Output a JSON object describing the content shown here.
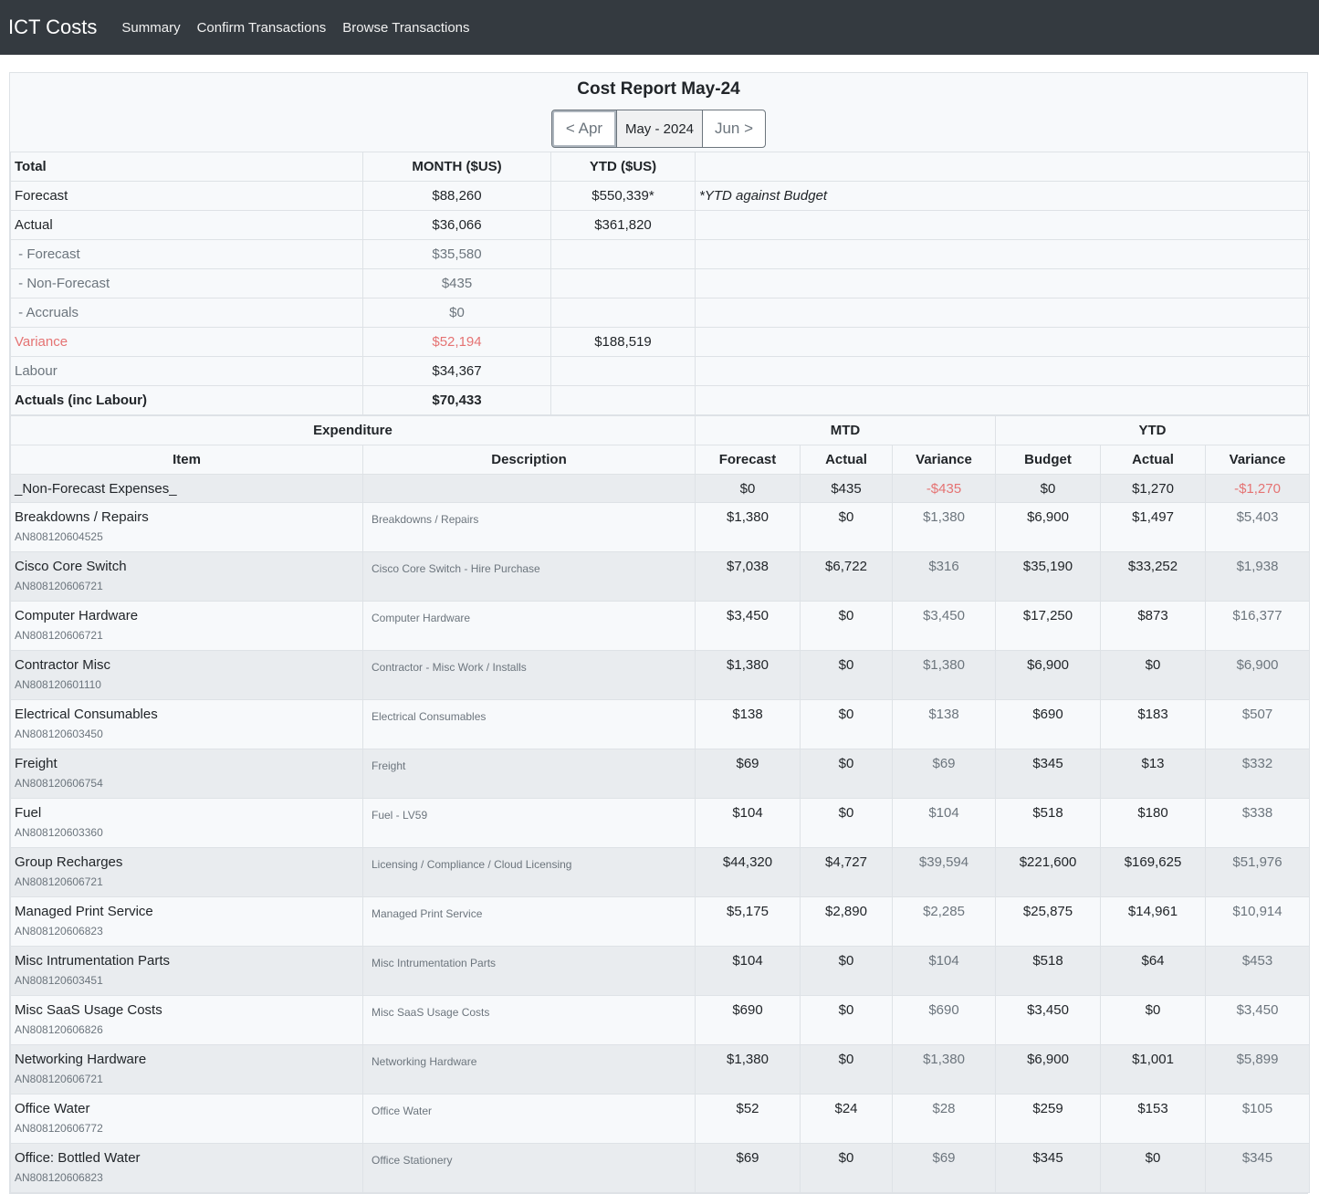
{
  "nav": {
    "brand": "ICT Costs",
    "links": [
      "Summary",
      "Confirm Transactions",
      "Browse Transactions"
    ]
  },
  "report": {
    "title": "Cost Report May-24",
    "prev": "< Apr",
    "current": "May - 2024",
    "next": "Jun >"
  },
  "summary": {
    "headers": [
      "Total",
      "MONTH ($US)",
      "YTD ($US)"
    ],
    "rows": [
      {
        "label": "Forecast",
        "month": "$88,260",
        "ytd": "$550,339*",
        "note": "*YTD against Budget"
      },
      {
        "label": "Actual",
        "month": "$36,066",
        "ytd": "$361,820",
        "note": ""
      },
      {
        "label": " - Forecast",
        "month": "$35,580",
        "ytd": "",
        "note": ""
      },
      {
        "label": " - Non-Forecast",
        "month": "$435",
        "ytd": "",
        "note": ""
      },
      {
        "label": " - Accruals",
        "month": "$0",
        "ytd": "",
        "note": ""
      },
      {
        "label": "Variance",
        "month": "$52,194",
        "ytd": "$188,519",
        "note": ""
      },
      {
        "label": "Labour",
        "month": "$34,367",
        "ytd": "",
        "note": ""
      },
      {
        "label": "Actuals (inc Labour)",
        "month": "$70,433",
        "ytd": "",
        "note": ""
      }
    ]
  },
  "detail": {
    "group_headers": [
      "Expenditure",
      "MTD",
      "YTD"
    ],
    "columns": [
      "Item",
      "Description",
      "Forecast",
      "Actual",
      "Variance",
      "Budget",
      "Actual",
      "Variance"
    ],
    "first_row": {
      "item": "_Non-Forecast Expenses_",
      "desc": "",
      "forecast": "$0",
      "actual": "$435",
      "variance": "-$435",
      "budget": "$0",
      "ytd_actual": "$1,270",
      "ytd_variance": "-$1,270"
    },
    "rows": [
      {
        "item": "Breakdowns / Repairs",
        "code": "AN808120604525",
        "desc": "Breakdowns / Repairs",
        "forecast": "$1,380",
        "actual": "$0",
        "variance": "$1,380",
        "budget": "$6,900",
        "ytd_actual": "$1,497",
        "ytd_variance": "$5,403"
      },
      {
        "item": "Cisco Core Switch",
        "code": "AN808120606721",
        "desc": "Cisco Core Switch - Hire Purchase",
        "forecast": "$7,038",
        "actual": "$6,722",
        "variance": "$316",
        "budget": "$35,190",
        "ytd_actual": "$33,252",
        "ytd_variance": "$1,938"
      },
      {
        "item": "Computer Hardware",
        "code": "AN808120606721",
        "desc": "Computer Hardware",
        "forecast": "$3,450",
        "actual": "$0",
        "variance": "$3,450",
        "budget": "$17,250",
        "ytd_actual": "$873",
        "ytd_variance": "$16,377"
      },
      {
        "item": "Contractor Misc",
        "code": "AN808120601110",
        "desc": "Contractor - Misc Work / Installs",
        "forecast": "$1,380",
        "actual": "$0",
        "variance": "$1,380",
        "budget": "$6,900",
        "ytd_actual": "$0",
        "ytd_variance": "$6,900"
      },
      {
        "item": "Electrical Consumables",
        "code": "AN808120603450",
        "desc": "Electrical Consumables",
        "forecast": "$138",
        "actual": "$0",
        "variance": "$138",
        "budget": "$690",
        "ytd_actual": "$183",
        "ytd_variance": "$507"
      },
      {
        "item": "Freight",
        "code": "AN808120606754",
        "desc": "Freight",
        "forecast": "$69",
        "actual": "$0",
        "variance": "$69",
        "budget": "$345",
        "ytd_actual": "$13",
        "ytd_variance": "$332"
      },
      {
        "item": "Fuel",
        "code": "AN808120603360",
        "desc": "Fuel - LV59",
        "forecast": "$104",
        "actual": "$0",
        "variance": "$104",
        "budget": "$518",
        "ytd_actual": "$180",
        "ytd_variance": "$338"
      },
      {
        "item": "Group Recharges",
        "code": "AN808120606721",
        "desc": "Licensing / Compliance / Cloud Licensing",
        "forecast": "$44,320",
        "actual": "$4,727",
        "variance": "$39,594",
        "budget": "$221,600",
        "ytd_actual": "$169,625",
        "ytd_variance": "$51,976"
      },
      {
        "item": "Managed Print Service",
        "code": "AN808120606823",
        "desc": "Managed Print Service",
        "forecast": "$5,175",
        "actual": "$2,890",
        "variance": "$2,285",
        "budget": "$25,875",
        "ytd_actual": "$14,961",
        "ytd_variance": "$10,914"
      },
      {
        "item": "Misc Intrumentation Parts",
        "code": "AN808120603451",
        "desc": "Misc Intrumentation Parts",
        "forecast": "$104",
        "actual": "$0",
        "variance": "$104",
        "budget": "$518",
        "ytd_actual": "$64",
        "ytd_variance": "$453"
      },
      {
        "item": "Misc SaaS Usage Costs",
        "code": "AN808120606826",
        "desc": "Misc SaaS Usage Costs",
        "forecast": "$690",
        "actual": "$0",
        "variance": "$690",
        "budget": "$3,450",
        "ytd_actual": "$0",
        "ytd_variance": "$3,450"
      },
      {
        "item": "Networking Hardware",
        "code": "AN808120606721",
        "desc": "Networking Hardware",
        "forecast": "$1,380",
        "actual": "$0",
        "variance": "$1,380",
        "budget": "$6,900",
        "ytd_actual": "$1,001",
        "ytd_variance": "$5,899"
      },
      {
        "item": "Office Water",
        "code": "AN808120606772",
        "desc": "Office Water",
        "forecast": "$52",
        "actual": "$24",
        "variance": "$28",
        "budget": "$259",
        "ytd_actual": "$153",
        "ytd_variance": "$105"
      },
      {
        "item": "Office: Bottled Water",
        "code": "AN808120606823",
        "desc": "Office Stationery",
        "forecast": "$69",
        "actual": "$0",
        "variance": "$69",
        "budget": "$345",
        "ytd_actual": "$0",
        "ytd_variance": "$345"
      }
    ]
  },
  "colors": {
    "navbar": "#343a40",
    "negative": "#e57373",
    "muted": "#6c757d"
  }
}
